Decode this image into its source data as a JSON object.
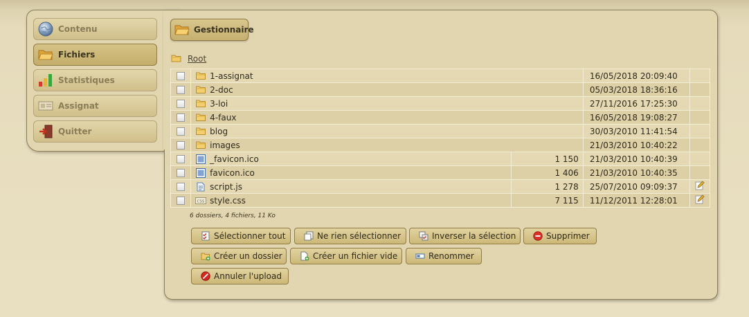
{
  "nav": {
    "items": [
      {
        "label": "Contenu",
        "icon": "globe-icon",
        "active": false
      },
      {
        "label": "Fichiers",
        "icon": "folder-icon",
        "active": true
      },
      {
        "label": "Statistiques",
        "icon": "bar-chart-icon",
        "active": false
      },
      {
        "label": "Assignat",
        "icon": "banknote-icon",
        "active": false
      },
      {
        "label": "Quitter",
        "icon": "exit-door-icon",
        "active": false
      }
    ]
  },
  "header": {
    "button_label": "Gestionnaire"
  },
  "breadcrumb": {
    "root_label": "Root"
  },
  "files": [
    {
      "name": "1-assignat",
      "type": "folder",
      "size": "",
      "date": "16/05/2018 20:09:40",
      "editable": false
    },
    {
      "name": "2-doc",
      "type": "folder",
      "size": "",
      "date": "05/03/2018 18:36:16",
      "editable": false
    },
    {
      "name": "3-loi",
      "type": "folder",
      "size": "",
      "date": "27/11/2016 17:25:30",
      "editable": false
    },
    {
      "name": "4-faux",
      "type": "folder",
      "size": "",
      "date": "16/05/2018 19:08:27",
      "editable": false
    },
    {
      "name": "blog",
      "type": "folder",
      "size": "",
      "date": "30/03/2010 11:41:54",
      "editable": false
    },
    {
      "name": "images",
      "type": "folder",
      "size": "",
      "date": "21/03/2010 10:40:22",
      "editable": false
    },
    {
      "name": "_favicon.ico",
      "type": "image",
      "size": "1 150",
      "date": "21/03/2010 10:40:39",
      "editable": false
    },
    {
      "name": "favicon.ico",
      "type": "image",
      "size": "1 406",
      "date": "21/03/2010 10:40:35",
      "editable": false
    },
    {
      "name": "script.js",
      "type": "script",
      "size": "1 278",
      "date": "25/07/2010 09:09:37",
      "editable": true
    },
    {
      "name": "style.css",
      "type": "css",
      "size": "7 115",
      "date": "11/12/2011 12:28:01",
      "editable": true
    }
  ],
  "summary": "6 dossiers, 4 fichiers, 11 Ko",
  "actions": {
    "select_all": "Sélectionner tout",
    "select_none": "Ne rien sélectionner",
    "invert": "Inverser la sélection",
    "delete": "Supprimer",
    "new_folder": "Créer un dossier",
    "new_file": "Créer un fichier vide",
    "rename": "Renommer",
    "cancel_upload": "Annuler l'upload"
  }
}
